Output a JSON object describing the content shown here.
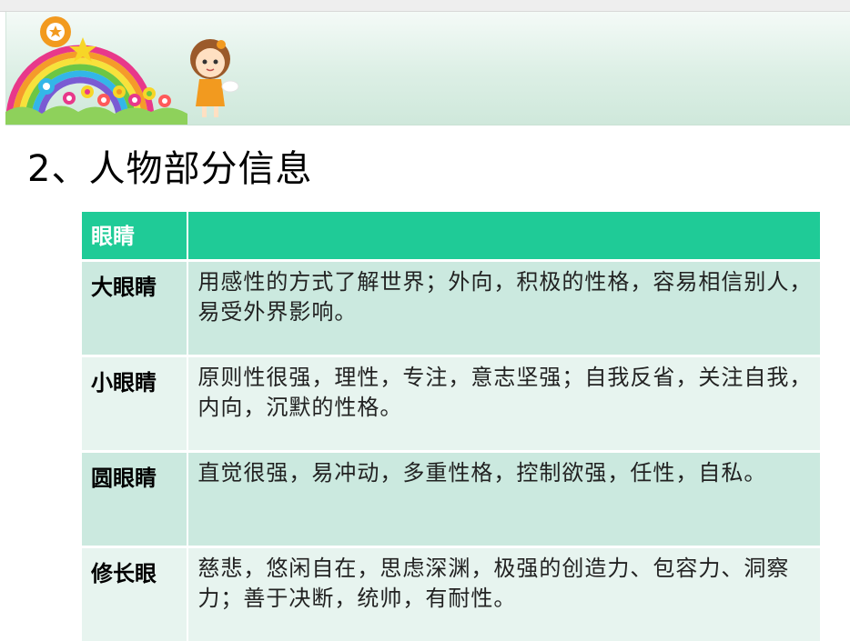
{
  "title": "2、人物部分信息",
  "table": {
    "header": [
      "眼睛",
      ""
    ],
    "rows": [
      {
        "key": "大眼睛",
        "desc": "用感性的方式了解世界；外向，积极的性格，容易相信别人，易受外界影响。"
      },
      {
        "key": "小眼睛",
        "desc": "原则性很强，理性，专注，意志坚强；自我反省，关注自我，内向，沉默的性格。"
      },
      {
        "key": "圆眼睛",
        "desc": "直觉很强，易冲动，多重性格，控制欲强，任性，自私。"
      },
      {
        "key": "修长眼",
        "desc": "慈悲，悠闲自在，思虑深渊，极强的创造力、包容力、洞察力；善于决断，统帅，有耐性。"
      }
    ]
  },
  "colors": {
    "header_bg": "#1fcb97",
    "row_odd_bg": "#cbe9df",
    "row_even_bg": "#e7f4ef",
    "banner_bg": "#dcefe5"
  }
}
